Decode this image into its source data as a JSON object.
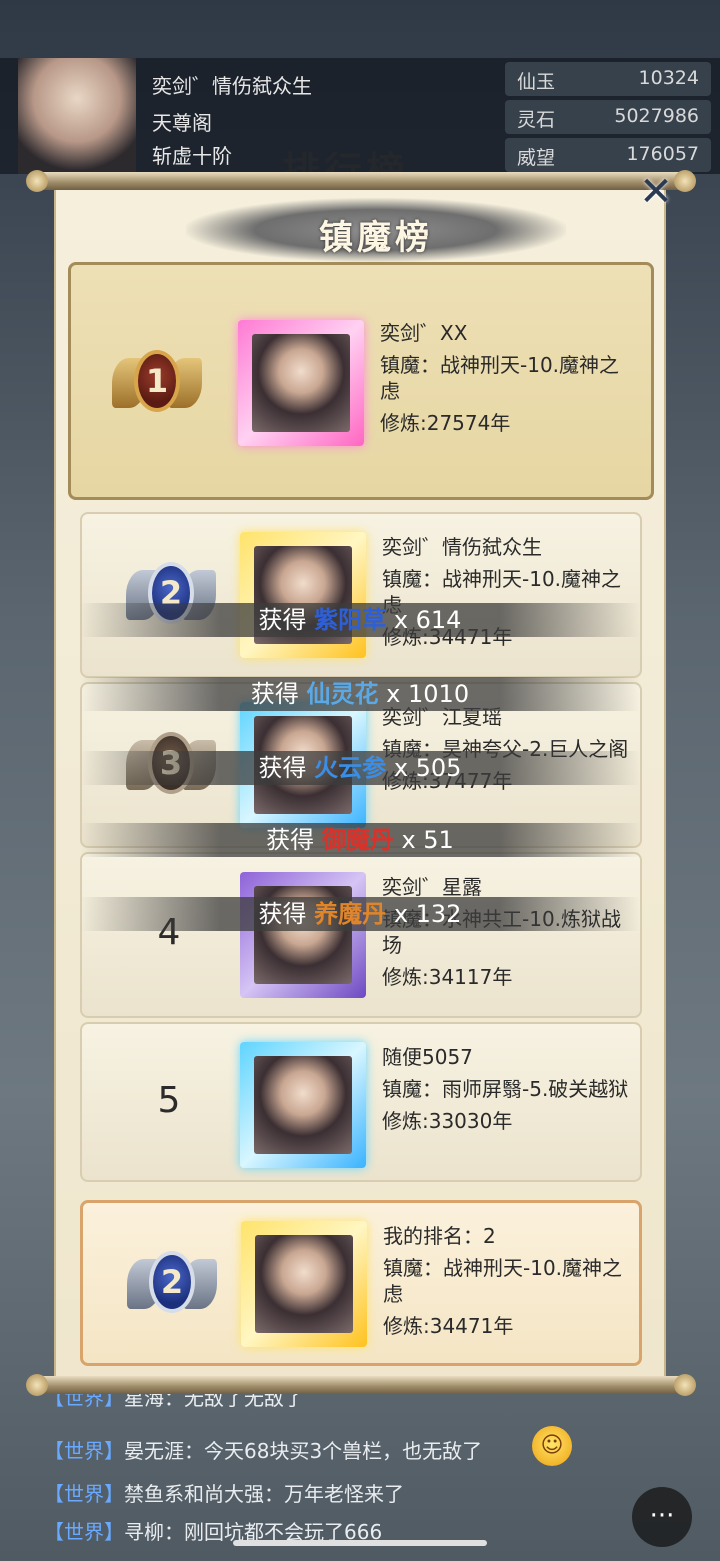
{
  "player": {
    "name": "奕剑゛情伤弑众生",
    "sect": "天尊阁",
    "realm": "斩虚十阶"
  },
  "resources": [
    {
      "label": "仙玉",
      "value": "10324"
    },
    {
      "label": "灵石",
      "value": "5027986"
    },
    {
      "label": "威望",
      "value": "176057"
    }
  ],
  "background_title": "排行榜",
  "modal": {
    "title": "镇魔榜",
    "close_icon": "close-icon",
    "entries": [
      {
        "rank": "1",
        "name": "奕剑゛XX",
        "demon": "镇魔：战神刑天-10.魔神之虑",
        "cultivation": "修炼:27574年",
        "frame": "pink"
      },
      {
        "rank": "2",
        "name": "奕剑゛情伤弑众生",
        "demon": "镇魔：战神刑天-10.魔神之虑",
        "cultivation": "修炼:34471年",
        "frame": "gold"
      },
      {
        "rank": "3",
        "name": "奕剑゛江夏瑶",
        "demon": "镇魔：昊神夸父-2.巨人之阁",
        "cultivation": "修炼:37477年",
        "frame": "blue"
      },
      {
        "rank": "4",
        "name": "奕剑゛星露",
        "demon": "镇魔：水神共工-10.炼狱战场",
        "cultivation": "修炼:34117年",
        "frame": "purple"
      },
      {
        "rank": "5",
        "name": "随便5057",
        "demon": "镇魔：雨师屏翳-5.破关越狱",
        "cultivation": "修炼:33030年",
        "frame": "blue"
      }
    ],
    "my_rank": {
      "label": "我的排名：2",
      "rank": "2",
      "demon": "镇魔：战神刑天-10.魔神之虑",
      "cultivation": "修炼:34471年"
    }
  },
  "rewards": [
    {
      "prefix": "获得",
      "item": "紫阳草",
      "count": "x 614",
      "color": "#2d5fd8"
    },
    {
      "prefix": "获得",
      "item": "仙灵花",
      "count": "x 1010",
      "color": "#5aa9e6"
    },
    {
      "prefix": "获得",
      "item": "火云参",
      "count": "x 505",
      "color": "#3a8ee8"
    },
    {
      "prefix": "获得",
      "item": "御魔丹",
      "count": "x 51",
      "color": "#d8322a"
    },
    {
      "prefix": "获得",
      "item": "养魔丹",
      "count": "x 132",
      "color": "#e0852a"
    }
  ],
  "chat": [
    {
      "channel": "【世界】",
      "text": "星海：无敌了无敌了"
    },
    {
      "channel": "【世界】",
      "text": "晏无涯：今天68块买3个兽栏，也无敌了"
    },
    {
      "channel": "【世界】",
      "text": "禁鱼系和尚大强：万年老怪来了"
    },
    {
      "channel": "【世界】",
      "text": "寻柳：刚回坑都不会玩了666"
    }
  ]
}
